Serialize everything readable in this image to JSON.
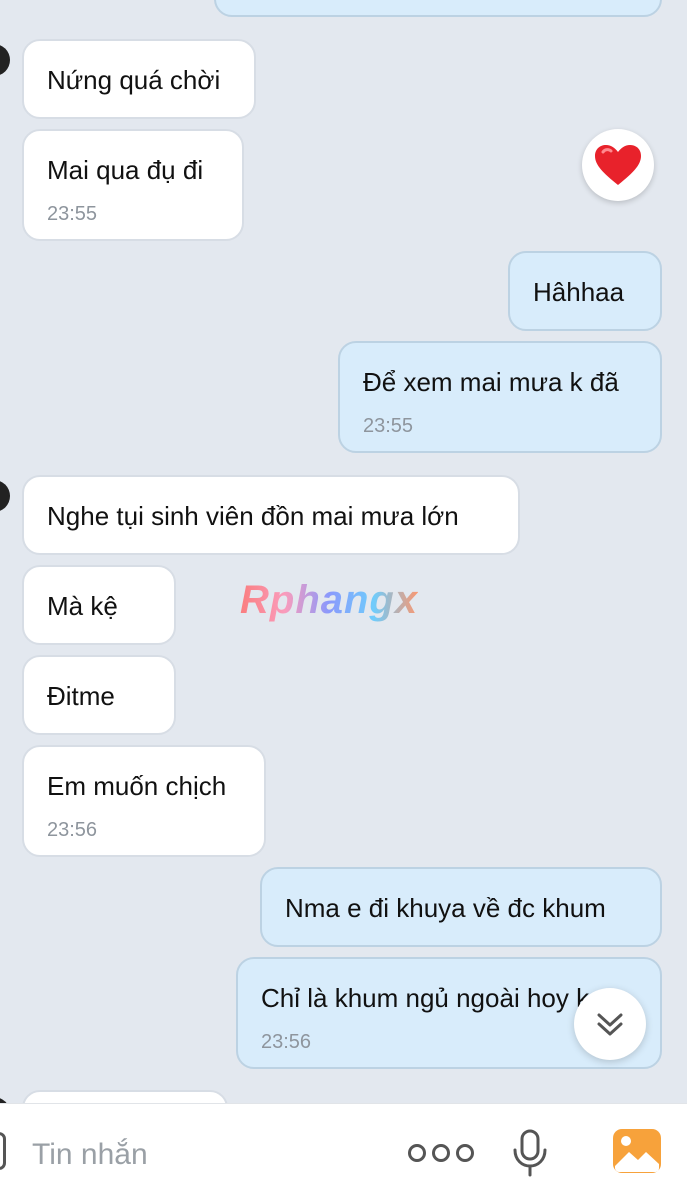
{
  "messages": [
    {
      "side": "out",
      "text": "",
      "time": ""
    },
    {
      "side": "in",
      "text": "Nứng quá chời",
      "time": ""
    },
    {
      "side": "in",
      "text": "Mai qua đụ đi",
      "time": "23:55"
    },
    {
      "side": "out",
      "text": "Hâhhaa",
      "time": ""
    },
    {
      "side": "out",
      "text": "Để xem mai mưa k đã",
      "time": "23:55"
    },
    {
      "side": "in",
      "text": "Nghe tụi sinh viên đồn mai mưa lớn",
      "time": ""
    },
    {
      "side": "in",
      "text": "Mà kệ",
      "time": ""
    },
    {
      "side": "in",
      "text": "Đitme",
      "time": ""
    },
    {
      "side": "in",
      "text": "Em muốn chịch",
      "time": "23:56"
    },
    {
      "side": "out",
      "text": "Nma e đi khuya về đc khum",
      "time": ""
    },
    {
      "side": "out",
      "text": "Chỉ là khum ngủ ngoài hoy k",
      "time": "23:56"
    }
  ],
  "reaction": {
    "icon": "heart-icon",
    "color": "#e8222b"
  },
  "watermark": "Rphangx",
  "composer": {
    "placeholder": "Tin nhắn"
  },
  "icons": {
    "more": "more-options-icon",
    "mic": "microphone-icon",
    "image": "image-picker-icon",
    "scroll": "scroll-down-icon"
  },
  "colors": {
    "background": "#e3e8ef",
    "incoming_bubble": "#ffffff",
    "outgoing_bubble": "#d8ecfb",
    "timestamp": "#8e959d",
    "accent_image_icon": "#f7a23b"
  }
}
